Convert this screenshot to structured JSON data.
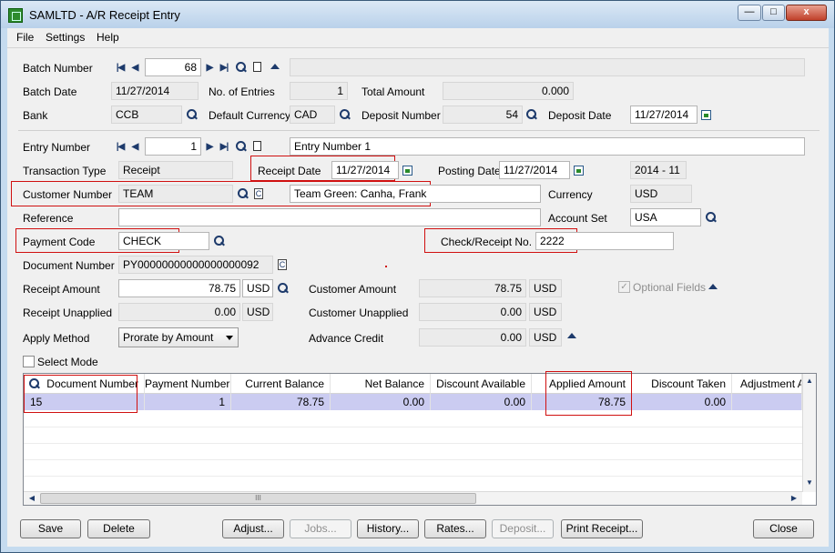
{
  "window": {
    "title": "SAMLTD - A/R Receipt Entry",
    "min_glyph": "—",
    "max_glyph": "□",
    "close_glyph": "x"
  },
  "menu": [
    "File",
    "Settings",
    "Help"
  ],
  "batch": {
    "number_label": "Batch Number",
    "number": "68",
    "description": "",
    "date_label": "Batch Date",
    "date": "11/27/2014",
    "entries_label": "No. of Entries",
    "entries": "1",
    "total_label": "Total Amount",
    "total": "0.000",
    "bank_label": "Bank",
    "bank": "CCB",
    "currency_label": "Default Currency",
    "currency": "CAD",
    "deposit_number_label": "Deposit Number",
    "deposit_number": "54",
    "deposit_date_label": "Deposit Date",
    "deposit_date": "11/27/2014"
  },
  "entry": {
    "number_label": "Entry Number",
    "number": "1",
    "description": "Entry Number 1",
    "type_label": "Transaction Type",
    "type": "Receipt",
    "receipt_date_label": "Receipt Date",
    "receipt_date": "11/27/2014",
    "posting_date_label": "Posting Date",
    "posting_date": "11/27/2014",
    "period": "2014 - 11",
    "customer_label": "Customer Number",
    "customer": "TEAM",
    "customer_name": "Team Green: Canha, Frank",
    "currency_label": "Currency",
    "currency": "USD",
    "reference_label": "Reference",
    "reference": "",
    "account_set_label": "Account Set",
    "account_set": "USA",
    "payment_code_label": "Payment Code",
    "payment_code": "CHECK",
    "check_label": "Check/Receipt No.",
    "check_no": "2222",
    "document_label": "Document Number",
    "document": "PY00000000000000000092",
    "receipt_amount_label": "Receipt Amount",
    "receipt_amount": "78.75",
    "receipt_currency": "USD",
    "customer_amount_label": "Customer Amount",
    "customer_amount": "78.75",
    "customer_amount_currency": "USD",
    "optional_fields_label": "Optional Fields",
    "unapplied_label": "Receipt Unapplied",
    "unapplied": "0.00",
    "unapplied_currency": "USD",
    "cust_unapplied_label": "Customer Unapplied",
    "cust_unapplied": "0.00",
    "cust_unapplied_currency": "USD",
    "apply_method_label": "Apply Method",
    "apply_method": "Prorate by Amount",
    "advance_credit_label": "Advance Credit",
    "advance_credit": "0.00",
    "advance_currency": "USD",
    "select_mode_label": "Select Mode"
  },
  "grid": {
    "columns": [
      "Document Number",
      "Payment Number",
      "Current Balance",
      "Net Balance",
      "Discount Available",
      "Applied Amount",
      "Discount Taken",
      "Adjustment A"
    ],
    "rows": [
      [
        "15",
        "1",
        "78.75",
        "0.00",
        "0.00",
        "78.75",
        "0.00",
        ""
      ]
    ],
    "hscroll_grip": "III"
  },
  "buttons": {
    "save": "Save",
    "delete": "Delete",
    "adjust": "Adjust...",
    "jobs": "Jobs...",
    "history": "History...",
    "rates": "Rates...",
    "deposit": "Deposit...",
    "print_receipt": "Print Receipt...",
    "close": "Close"
  },
  "colors": {
    "frame": "#c5dbef",
    "selected_row": "#cbccf1",
    "highlight_box": "#d01010"
  },
  "icons": [
    "first-icon",
    "previous-icon",
    "next-icon",
    "last-icon",
    "search-icon",
    "new-document-icon",
    "collapse-icon",
    "calendar-icon",
    "zoom-icon",
    "scroll-up-icon",
    "scroll-down-icon",
    "scroll-left-icon",
    "scroll-right-icon"
  ]
}
